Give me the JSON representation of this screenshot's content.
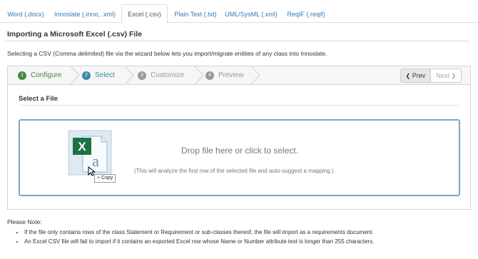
{
  "tabs": [
    {
      "label": "Word (.docx)",
      "active": false
    },
    {
      "label": "Innoslate (.inno, .xml)",
      "active": false
    },
    {
      "label": "Excel (.csv)",
      "active": true
    },
    {
      "label": "Plain Text (.txt)",
      "active": false
    },
    {
      "label": "UML/SysML (.xml)",
      "active": false
    },
    {
      "label": "ReqIF (.reqif)",
      "active": false
    }
  ],
  "page": {
    "title": "Importing a Microsoft Excel (.csv) File",
    "description": "Selecting a CSV (Comma delimited) file via the wizard below lets you import/migrate entities of any class into Innoslate."
  },
  "wizard": {
    "steps": [
      {
        "num": "1",
        "label": "Configure",
        "state": "done"
      },
      {
        "num": "2",
        "label": "Select",
        "state": "current"
      },
      {
        "num": "3",
        "label": "Customize",
        "state": "todo"
      },
      {
        "num": "4",
        "label": "Preview",
        "state": "todo"
      }
    ],
    "prev_label": "Prev",
    "next_label": "Next",
    "section_title": "Select a File",
    "drop_title": "Drop file here or click to select.",
    "drop_subtitle": "(This will analyze the first row of the selected file and auto-suggest a mapping.)",
    "copy_badge": "+ Copy",
    "file_icon_letter": "a",
    "excel_letter": "X"
  },
  "notes": {
    "heading": "Please Note:",
    "items": [
      "If the file only contains rows of the class Statement or Requirement or sub-classes thereof, the file will import as a requirements document.",
      "An Excel CSV file will fail to import if it contains an exported Excel row whose Name or Number attribute text is longer than 255 characters."
    ]
  },
  "colors": {
    "link": "#337ab7",
    "step_done": "#468847",
    "step_current": "#3a87ad",
    "step_todo": "#999999",
    "dropzone_border": "#7fa5c6",
    "excel_green": "#1e7145"
  },
  "icons": [
    "excel-file-icon",
    "copy-cursor-icon",
    "chevron-left-icon",
    "chevron-right-icon"
  ]
}
